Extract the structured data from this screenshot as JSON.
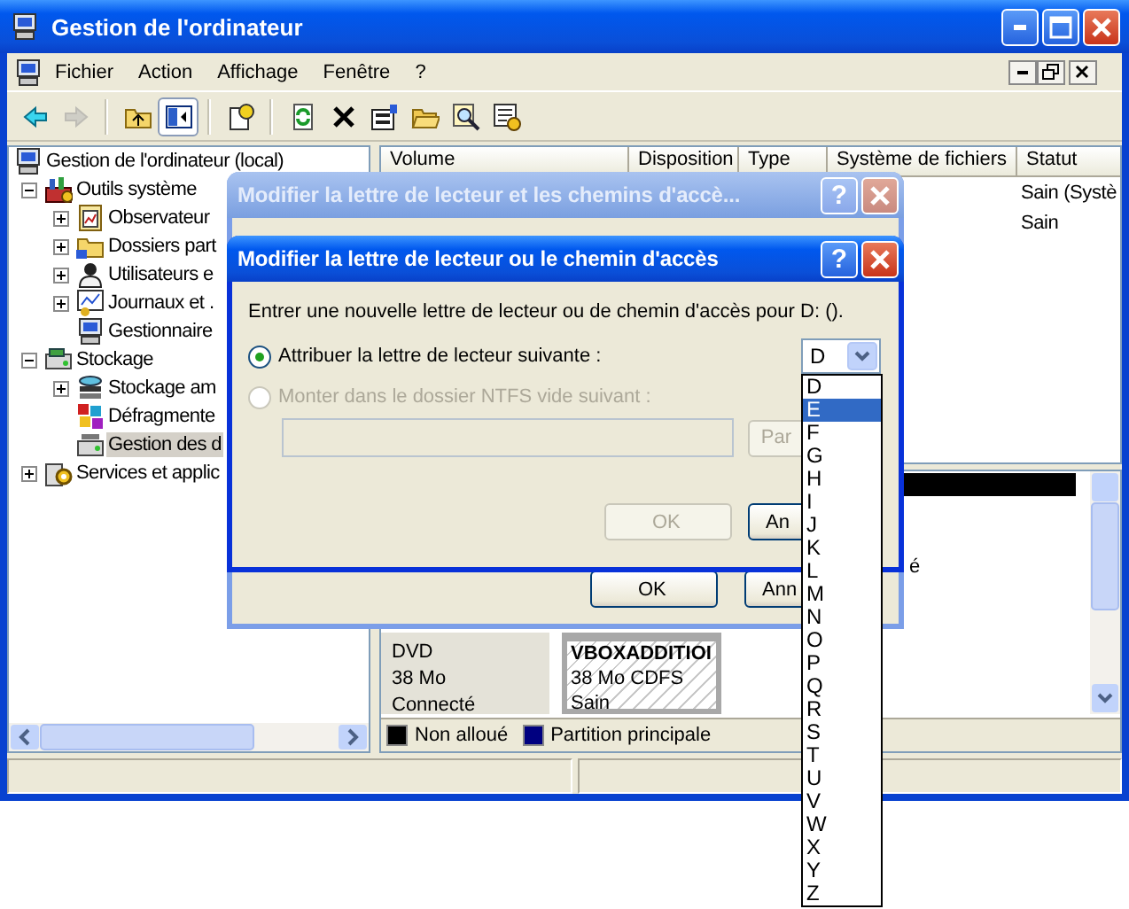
{
  "window": {
    "title": "Gestion de l'ordinateur"
  },
  "menu": [
    {
      "label": "Fichier"
    },
    {
      "label": "Action"
    },
    {
      "label": "Affichage"
    },
    {
      "label": "Fenêtre"
    },
    {
      "label": "?"
    }
  ],
  "toolbar": [
    [
      {
        "kind": "back",
        "disabled": false,
        "pressed": false
      },
      {
        "kind": "forward",
        "disabled": true,
        "pressed": false
      }
    ],
    [
      {
        "kind": "up",
        "disabled": false,
        "pressed": false
      },
      {
        "kind": "tree-toggle",
        "disabled": false,
        "pressed": true
      }
    ],
    [
      {
        "kind": "help",
        "disabled": false,
        "pressed": false
      }
    ],
    [
      {
        "kind": "refresh",
        "disabled": false,
        "pressed": false
      },
      {
        "kind": "delete",
        "disabled": false,
        "pressed": false
      },
      {
        "kind": "properties",
        "disabled": false,
        "pressed": false
      },
      {
        "kind": "open",
        "disabled": false,
        "pressed": false
      },
      {
        "kind": "search",
        "disabled": false,
        "pressed": false
      },
      {
        "kind": "settings",
        "disabled": false,
        "pressed": false
      }
    ]
  ],
  "tree": [
    {
      "label": "Gestion de l'ordinateur (local)",
      "kind": "computer",
      "selected": false,
      "children": [
        {
          "label": "Outils système",
          "kind": "tools",
          "expanded": true,
          "selected": false,
          "children": [
            {
              "label": "Observateur",
              "kind": "viewer",
              "expanded": false,
              "selected": false
            },
            {
              "label": "Dossiers part",
              "kind": "shared",
              "expanded": false,
              "selected": false
            },
            {
              "label": "Utilisateurs e",
              "kind": "users",
              "expanded": false,
              "selected": false
            },
            {
              "label": "Journaux et .",
              "kind": "logs",
              "expanded": false,
              "selected": false
            },
            {
              "label": "Gestionnaire",
              "kind": "devices",
              "selected": false
            }
          ]
        },
        {
          "label": "Stockage",
          "kind": "storage",
          "expanded": true,
          "selected": false,
          "children": [
            {
              "label": "Stockage am",
              "kind": "removable",
              "expanded": false,
              "selected": false
            },
            {
              "label": "Défragmente",
              "kind": "defrag",
              "selected": false
            },
            {
              "label": "Gestion des d",
              "kind": "disks",
              "selected": true
            }
          ]
        },
        {
          "label": "Services et applic",
          "kind": "services",
          "expanded": false,
          "selected": false
        }
      ]
    }
  ],
  "volume_list": {
    "columns": [
      "Volume",
      "Disposition",
      "Type",
      "Système de fichiers",
      "Statut"
    ],
    "rows": [
      {
        "status": "Sain (Systè"
      },
      {
        "status": "Sain"
      }
    ]
  },
  "disk_map": {
    "fragment": "é",
    "cdrom": {
      "lines": [
        "DVD",
        "38 Mo",
        "Connecté"
      ]
    },
    "partition": {
      "name": "VBOXADDITIOI",
      "lines": [
        "38 Mo CDFS",
        "Sain"
      ]
    },
    "legend": [
      {
        "label": "Non alloué",
        "color": "#000000"
      },
      {
        "label": "Partition principale",
        "color": "#000080"
      }
    ]
  },
  "dialogs": [
    {
      "title": "Modifier la lettre de lecteur et les chemins d'accè...",
      "active": false,
      "help": "?",
      "buttons": [
        {
          "label": "OK",
          "disabled": false
        },
        {
          "label": "Ann",
          "disabled": false
        }
      ]
    },
    {
      "title": "Modifier la lettre de lecteur ou le chemin d'accès",
      "active": true,
      "help": "?",
      "prompt": "Entrer une nouvelle lettre de lecteur ou de chemin d'accès pour D: ().",
      "options": [
        {
          "label": "Attribuer la lettre de lecteur suivante :",
          "selected": true,
          "disabled": false
        },
        {
          "label": "Monter dans le dossier NTFS vide suivant :",
          "selected": false,
          "disabled": true
        }
      ],
      "drive_letter": {
        "value": "D"
      },
      "folder_field": {
        "disabled": true
      },
      "browse_button": {
        "label": "Par",
        "disabled": true
      },
      "buttons": [
        {
          "label": "OK",
          "disabled": true
        },
        {
          "label": "An",
          "disabled": false
        }
      ]
    }
  ],
  "letter_list": [
    {
      "label": "D",
      "selected": false
    },
    {
      "label": "E",
      "selected": true
    },
    {
      "label": "F",
      "selected": false
    },
    {
      "label": "G",
      "selected": false
    },
    {
      "label": "H",
      "selected": false
    },
    {
      "label": "I",
      "selected": false
    },
    {
      "label": "J",
      "selected": false
    },
    {
      "label": "K",
      "selected": false
    },
    {
      "label": "L",
      "selected": false
    },
    {
      "label": "M",
      "selected": false
    },
    {
      "label": "N",
      "selected": false
    },
    {
      "label": "O",
      "selected": false
    },
    {
      "label": "P",
      "selected": false
    },
    {
      "label": "Q",
      "selected": false
    },
    {
      "label": "R",
      "selected": false
    },
    {
      "label": "S",
      "selected": false
    },
    {
      "label": "T",
      "selected": false
    },
    {
      "label": "U",
      "selected": false
    },
    {
      "label": "V",
      "selected": false
    },
    {
      "label": "W",
      "selected": false
    },
    {
      "label": "X",
      "selected": false
    },
    {
      "label": "Y",
      "selected": false
    },
    {
      "label": "Z",
      "selected": false
    }
  ]
}
